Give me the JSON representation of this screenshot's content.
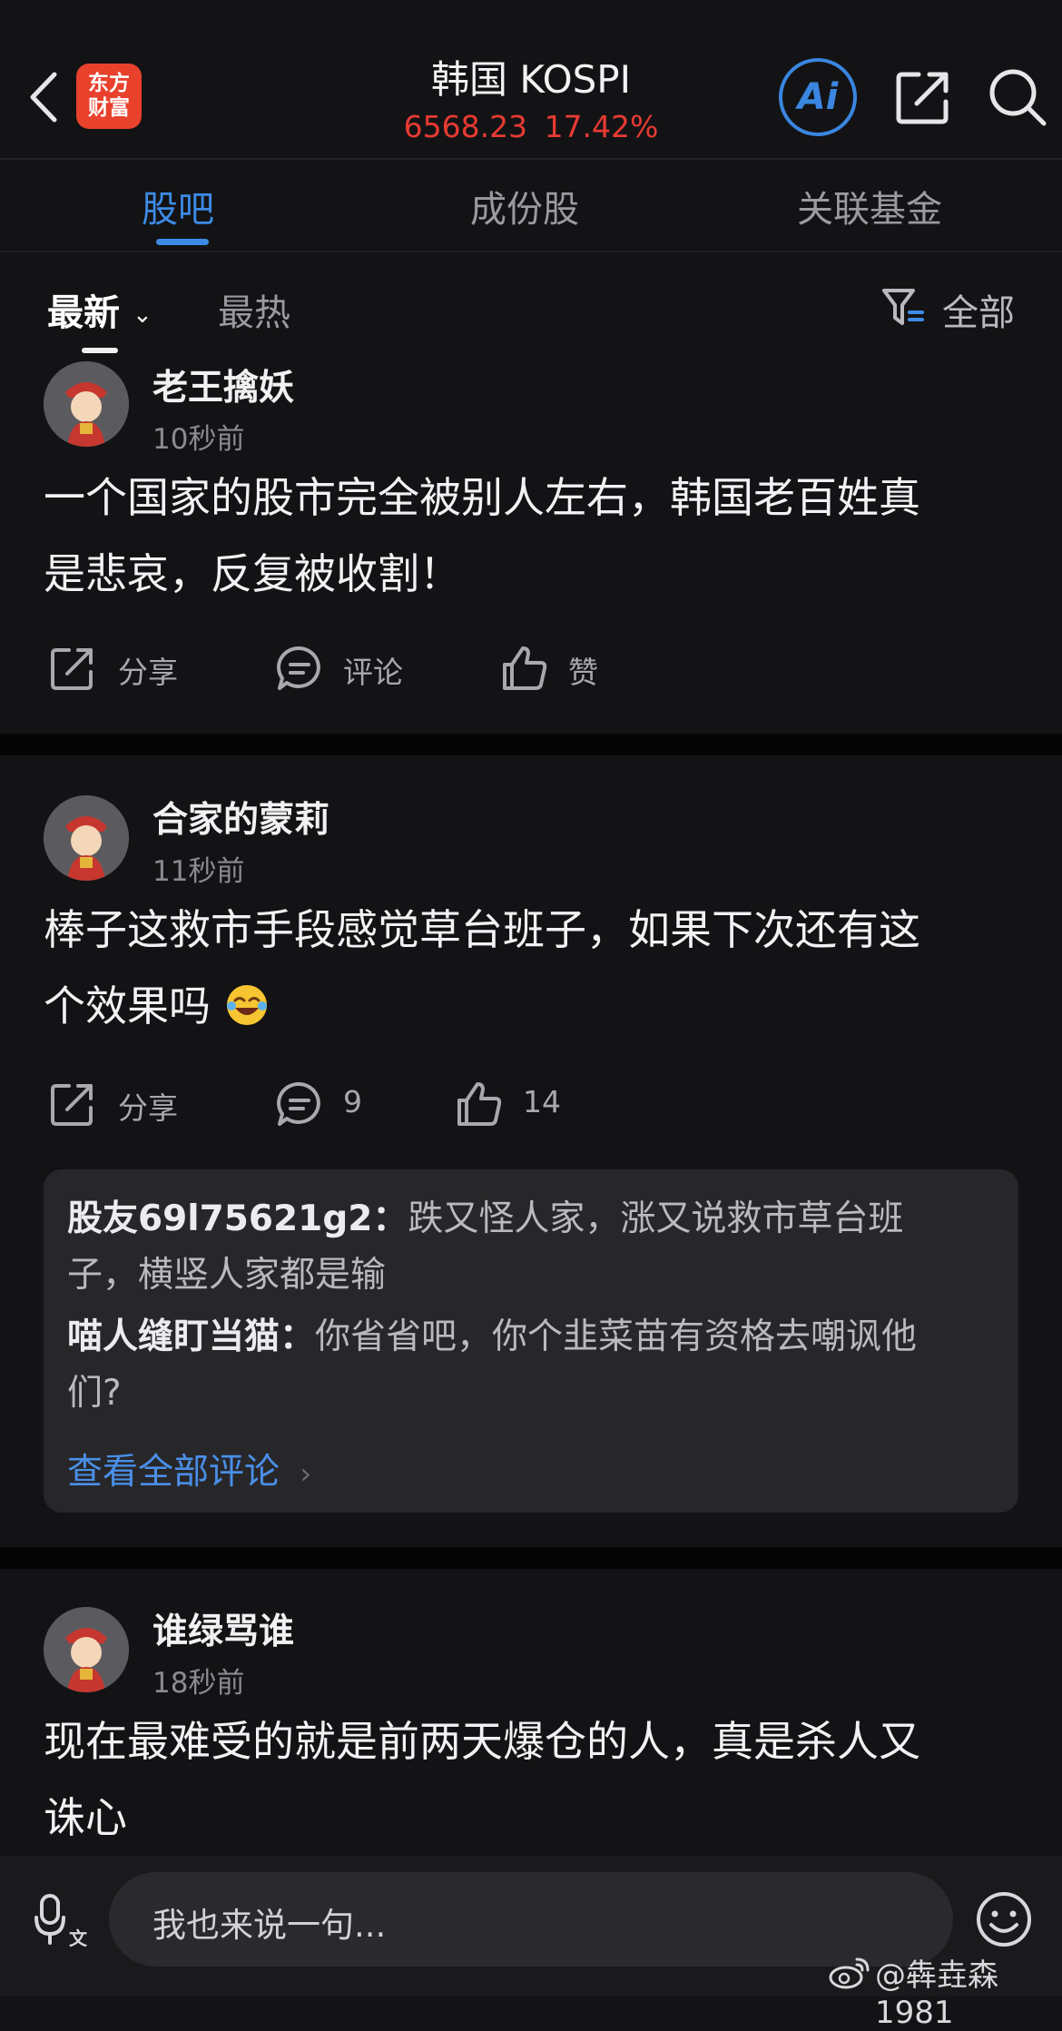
{
  "header": {
    "logo_line1": "东方",
    "logo_line2": "财富",
    "title": "韩国 KOSPI",
    "price": "6568.23",
    "change_pct": "17.42%",
    "ai_label": "Ai",
    "price_color": "#e83a33"
  },
  "tabs": [
    "股吧",
    "成份股",
    "关联基金"
  ],
  "sort": {
    "latest": "最新",
    "hot": "最热",
    "filter": "全部"
  },
  "posts": [
    {
      "user": "老王擒妖",
      "time": "10秒前",
      "line1": "一个国家的股市完全被别人左右，韩国老百姓真",
      "line2": "是悲哀，反复被收割！",
      "share": "分享",
      "comment": "评论",
      "like": "赞"
    },
    {
      "user": "合家的蒙莉",
      "time": "11秒前",
      "line1": "棒子这救市手段感觉草台班子，如果下次还有这",
      "line2": "个效果吗",
      "share": "分享",
      "comment": "9",
      "like": "14",
      "replies": [
        {
          "user": "股友69l75621g2：",
          "text1": "跌又怪人家，涨又说救市草台班",
          "text2": "子，横竖人家都是输"
        },
        {
          "user": "喵人缝盯当猫：",
          "text1": "你省省吧，你个韭菜苗有资格去嘲讽他",
          "text2": "们?"
        }
      ],
      "view_all": "查看全部评论"
    },
    {
      "user": "谁绿骂谁",
      "time": "18秒前",
      "line1": "现在最难受的就是前两天爆仓的人，真是杀人又",
      "line2": "诛心"
    }
  ],
  "composer": {
    "placeholder": "我也来说一句..."
  },
  "watermark": "@犇垚森1981"
}
